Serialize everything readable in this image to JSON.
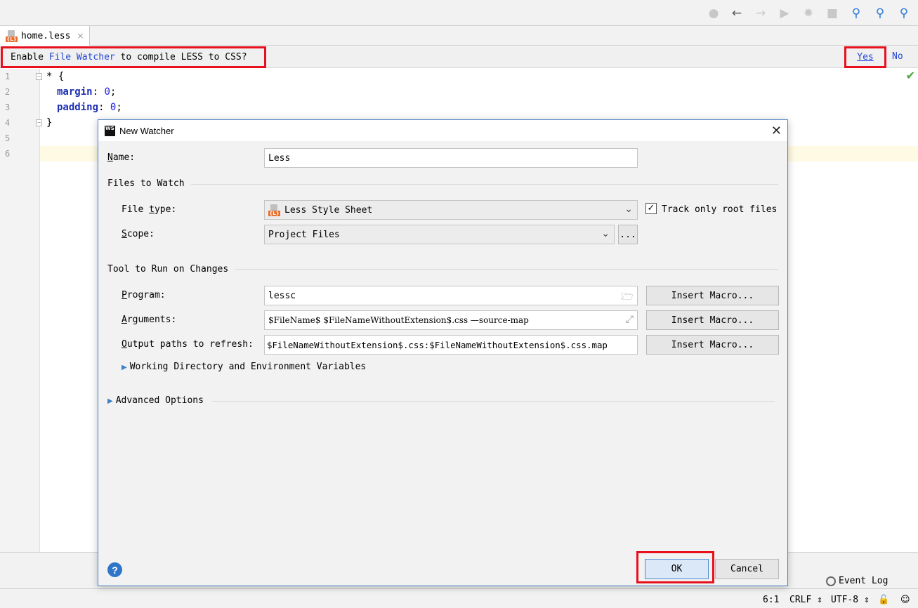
{
  "toolbar": {
    "icons": [
      "user-icon",
      "back-arrow-icon",
      "forward-arrow-icon",
      "run-icon",
      "debug-icon",
      "stop-icon",
      "search-icon",
      "find-icon",
      "find-usages-icon"
    ]
  },
  "tab": {
    "filename": "home.less",
    "close": "×"
  },
  "notification": {
    "prefix": "Enable ",
    "link": "File Watcher",
    "suffix": " to compile LESS to CSS?",
    "yes": "Yes",
    "no": "No"
  },
  "editor": {
    "line_numbers": [
      "1",
      "2",
      "3",
      "4",
      "5",
      "6"
    ],
    "line1": "* {",
    "line2_prop": "margin",
    "line2_sep": ": ",
    "line2_val": "0",
    "line2_end": ";",
    "line3_prop": "padding",
    "line3_sep": ": ",
    "line3_val": "0",
    "line3_end": ";",
    "line4": "}"
  },
  "dialog": {
    "title": "New Watcher",
    "name_label": "Name:",
    "name_value": "Less",
    "files_section": "Files to Watch",
    "file_type_label": "File type:",
    "file_type_value": "Less Style Sheet",
    "track_only_root": "Track only root files",
    "track_checked": true,
    "scope_label": "Scope:",
    "scope_value": "Project Files",
    "scope_more": "...",
    "tool_section": "Tool to Run on Changes",
    "program_label": "Program:",
    "program_value": "lessc",
    "arguments_label": "Arguments:",
    "arguments_value": "$FileName$ $FileNameWithoutExtension$.css —source-map",
    "output_label": "Output paths to refresh:",
    "output_value": "$FileNameWithoutExtension$.css:$FileNameWithoutExtension$.css.map",
    "insert_macro": "Insert Macro...",
    "working_dir": "Working Directory and Environment Variables",
    "advanced": "Advanced Options",
    "help": "?",
    "ok": "OK",
    "cancel": "Cancel"
  },
  "tool_strip": {
    "event_log": "Event Log"
  },
  "status": {
    "position": "6:1",
    "line_sep": "CRLF ⇕",
    "encoding": "UTF-8 ⇕"
  },
  "colors": {
    "highlight": "#e8101d",
    "link": "#2346d6",
    "accent": "#2f76c9"
  }
}
